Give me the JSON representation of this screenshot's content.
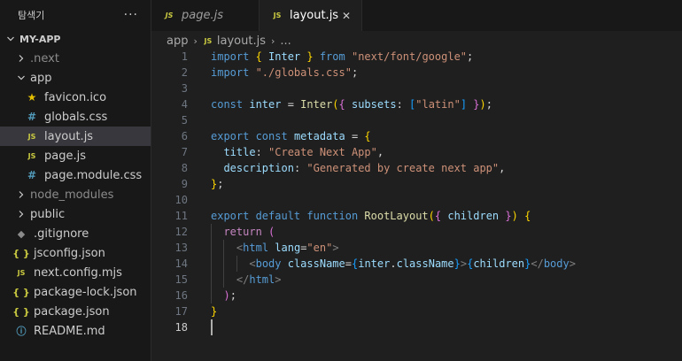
{
  "sidebar": {
    "title": "탐색기",
    "more": "···",
    "root": "MY-APP",
    "items": [
      {
        "label": ".next",
        "type": "folder",
        "depth": 1,
        "expanded": false,
        "dim": true
      },
      {
        "label": "app",
        "type": "folder",
        "depth": 1,
        "expanded": true
      },
      {
        "label": "favicon.ico",
        "type": "file",
        "icon": "star-icon",
        "depth": 2
      },
      {
        "label": "globals.css",
        "type": "file",
        "icon": "css-icon",
        "depth": 2
      },
      {
        "label": "layout.js",
        "type": "file",
        "icon": "js-icon",
        "depth": 2,
        "selected": true
      },
      {
        "label": "page.js",
        "type": "file",
        "icon": "js-icon",
        "depth": 2
      },
      {
        "label": "page.module.css",
        "type": "file",
        "icon": "css-icon",
        "depth": 2
      },
      {
        "label": "node_modules",
        "type": "folder",
        "depth": 1,
        "expanded": false,
        "dim": true
      },
      {
        "label": "public",
        "type": "folder",
        "depth": 1,
        "expanded": false
      },
      {
        "label": ".gitignore",
        "type": "file",
        "icon": "git-icon",
        "depth": 1
      },
      {
        "label": "jsconfig.json",
        "type": "file",
        "icon": "json-icon",
        "depth": 1
      },
      {
        "label": "next.config.mjs",
        "type": "file",
        "icon": "js-icon",
        "depth": 1
      },
      {
        "label": "package-lock.json",
        "type": "file",
        "icon": "json-icon",
        "depth": 1
      },
      {
        "label": "package.json",
        "type": "file",
        "icon": "json-icon",
        "depth": 1
      },
      {
        "label": "README.md",
        "type": "file",
        "icon": "info-icon",
        "depth": 1
      }
    ]
  },
  "tabs": [
    {
      "label": "page.js",
      "active": false
    },
    {
      "label": "layout.js",
      "active": true,
      "close": "✕"
    }
  ],
  "icons": {
    "js": "JS",
    "json": "{ }",
    "css": "#",
    "star": "★",
    "git": "◆",
    "info": "ⓘ"
  },
  "breadcrumb": {
    "folder": "app",
    "file": "layout.js",
    "sep": "›",
    "tail": "..."
  },
  "editor": {
    "current_line": 18,
    "lines": [
      [
        [
          "kw",
          "import "
        ],
        [
          "b1",
          "{ "
        ],
        [
          "var",
          "Inter"
        ],
        [
          "b1",
          " }"
        ],
        [
          "kw",
          " from "
        ],
        [
          "str",
          "\"next/font/google\""
        ],
        [
          "txt",
          ";"
        ]
      ],
      [
        [
          "kw",
          "import "
        ],
        [
          "str",
          "\"./globals.css\""
        ],
        [
          "txt",
          ";"
        ]
      ],
      [],
      [
        [
          "kw",
          "const "
        ],
        [
          "var",
          "inter"
        ],
        [
          "txt",
          " = "
        ],
        [
          "fn",
          "Inter"
        ],
        [
          "b1",
          "("
        ],
        [
          "b2",
          "{ "
        ],
        [
          "var",
          "subsets"
        ],
        [
          "txt",
          ": "
        ],
        [
          "b3",
          "["
        ],
        [
          "str",
          "\"latin\""
        ],
        [
          "b3",
          "]"
        ],
        [
          "b2",
          " }"
        ],
        [
          "b1",
          ")"
        ],
        [
          "txt",
          ";"
        ]
      ],
      [],
      [
        [
          "kw",
          "export "
        ],
        [
          "kw",
          "const "
        ],
        [
          "var",
          "metadata"
        ],
        [
          "txt",
          " = "
        ],
        [
          "b1",
          "{"
        ]
      ],
      [
        [
          "txt",
          "  "
        ],
        [
          "var",
          "title"
        ],
        [
          "txt",
          ": "
        ],
        [
          "str",
          "\"Create Next App\""
        ],
        [
          "txt",
          ","
        ]
      ],
      [
        [
          "txt",
          "  "
        ],
        [
          "var",
          "description"
        ],
        [
          "txt",
          ": "
        ],
        [
          "str",
          "\"Generated by create next app\""
        ],
        [
          "txt",
          ","
        ]
      ],
      [
        [
          "b1",
          "}"
        ],
        [
          "txt",
          ";"
        ]
      ],
      [],
      [
        [
          "kw",
          "export "
        ],
        [
          "kw",
          "default "
        ],
        [
          "kw",
          "function "
        ],
        [
          "fn",
          "RootLayout"
        ],
        [
          "b1",
          "("
        ],
        [
          "b2",
          "{ "
        ],
        [
          "var",
          "children"
        ],
        [
          "b2",
          " }"
        ],
        [
          "b1",
          ")"
        ],
        [
          "txt",
          " "
        ],
        [
          "b1",
          "{"
        ]
      ],
      [
        [
          "txt",
          "  "
        ],
        [
          "ctl",
          "return "
        ],
        [
          "b2",
          "("
        ]
      ],
      [
        [
          "txt",
          "    "
        ],
        [
          "ang",
          "<"
        ],
        [
          "tag",
          "html"
        ],
        [
          "txt",
          " "
        ],
        [
          "attr",
          "lang"
        ],
        [
          "txt",
          "="
        ],
        [
          "str",
          "\"en\""
        ],
        [
          "ang",
          ">"
        ]
      ],
      [
        [
          "txt",
          "      "
        ],
        [
          "ang",
          "<"
        ],
        [
          "tag",
          "body"
        ],
        [
          "txt",
          " "
        ],
        [
          "attr",
          "className"
        ],
        [
          "txt",
          "="
        ],
        [
          "b3",
          "{"
        ],
        [
          "var",
          "inter"
        ],
        [
          "txt",
          "."
        ],
        [
          "var",
          "className"
        ],
        [
          "b3",
          "}"
        ],
        [
          "ang",
          ">"
        ],
        [
          "b3",
          "{"
        ],
        [
          "var",
          "children"
        ],
        [
          "b3",
          "}"
        ],
        [
          "ang",
          "</"
        ],
        [
          "tag",
          "body"
        ],
        [
          "ang",
          ">"
        ]
      ],
      [
        [
          "txt",
          "    "
        ],
        [
          "ang",
          "</"
        ],
        [
          "tag",
          "html"
        ],
        [
          "ang",
          ">"
        ]
      ],
      [
        [
          "txt",
          "  "
        ],
        [
          "b2",
          ")"
        ],
        [
          "txt",
          ";"
        ]
      ],
      [
        [
          "b1",
          "}"
        ]
      ],
      []
    ]
  }
}
